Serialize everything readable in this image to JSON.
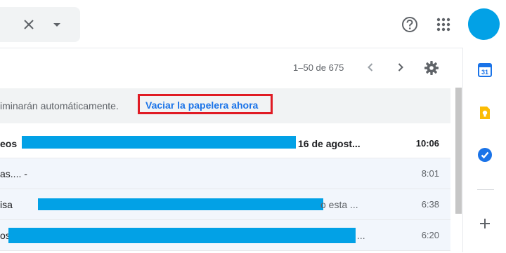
{
  "toolbar": {
    "page_count": "1–50 de 675"
  },
  "banner": {
    "text": "iminarán automáticamente.",
    "action_label": "Vaciar la papelera ahora"
  },
  "emails": [
    {
      "lead": "eos",
      "tail": "16 de agost...",
      "time": "10:06",
      "unread": true
    },
    {
      "lead": "as.... -",
      "tail": "",
      "time": "8:01",
      "unread": false
    },
    {
      "lead": "isa",
      "tail": "o esta ...",
      "time": "6:38",
      "unread": false
    },
    {
      "lead": "os",
      "tail": "...",
      "time": "6:20",
      "unread": false
    }
  ],
  "side_panel": {
    "calendar_day": "31"
  },
  "colors": {
    "accent": "#1a73e8",
    "highlight_border": "#e01b24",
    "redaction": "#02a1e6",
    "avatar": "#02a1e6"
  },
  "icons": [
    "close-icon",
    "dropdown-arrow-icon",
    "help-icon",
    "apps-grid-icon",
    "chevron-left-icon",
    "chevron-right-icon",
    "gear-icon",
    "calendar-icon",
    "keep-icon",
    "tasks-icon",
    "plus-icon"
  ]
}
